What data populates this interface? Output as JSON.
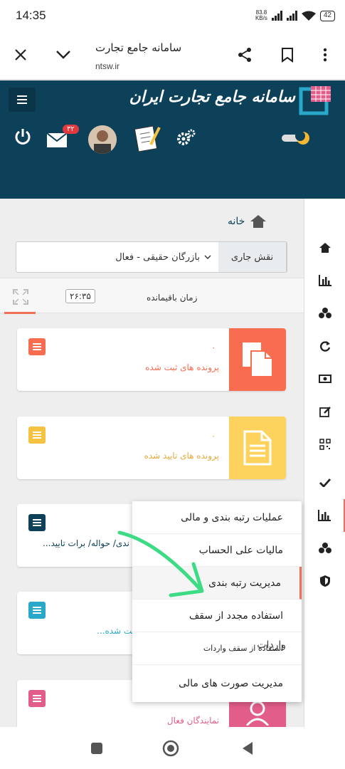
{
  "status_bar": {
    "time": "14:35",
    "net_speed_value": "83.8",
    "net_speed_unit": "KB/s",
    "battery": "42"
  },
  "browser": {
    "title": "سامانه جامع تجارت",
    "url": "ntsw.ir"
  },
  "header": {
    "logo_text": "سامانه جامع تجارت ایران",
    "notification_count": "۳۲",
    "brand_color": "#0c4159"
  },
  "breadcrumb": {
    "home_label": "خانه"
  },
  "role": {
    "label": "نقش جاری",
    "selected": "بازرگان حقیقی - فعال"
  },
  "timer": {
    "label": "زمان باقیمانده",
    "value": "۲۶:۳۵"
  },
  "cards": [
    {
      "count": "۰",
      "label": "پرونده های ثبت شده",
      "color": "#f86c4f",
      "menu_color": "#f86c4f",
      "icon": "files-icon"
    },
    {
      "count": "۰",
      "label": "پرونده های تایید شده",
      "color": "#fdd35d",
      "menu_color": "#f5c242",
      "icon": "document-icon"
    },
    {
      "count": "",
      "label": "...ندی/ حواله/ برات تایید",
      "color": "#0c4159",
      "menu_color": "#0c4159",
      "icon": ""
    },
    {
      "count": "",
      "label": "...یت شده",
      "color": "#2aa8c9",
      "menu_color": "#2aa8c9",
      "icon": ""
    },
    {
      "count": "",
      "label": "نمایندگان فعال",
      "color": "#e35d8b",
      "menu_color": "#e35d8b",
      "icon": "users-icon"
    }
  ],
  "popup_menu": {
    "items": [
      "عملیات رتبه بندی و مالی",
      "مالیات علی الحساب",
      "مدیریت رتبه بندی",
      "استفاده مجدد از سقف",
      "استفاده از سقف واردات",
      "مدیریت صورت های مالی"
    ],
    "overlap_text": "واردات"
  },
  "sidebar_icons": [
    "home-icon",
    "chart-icon",
    "cubes-icon",
    "refresh-icon",
    "money-icon",
    "edit-icon",
    "qr-icon",
    "check-icon",
    "chart-active-icon",
    "cubes-icon-2",
    "shield-icon"
  ]
}
